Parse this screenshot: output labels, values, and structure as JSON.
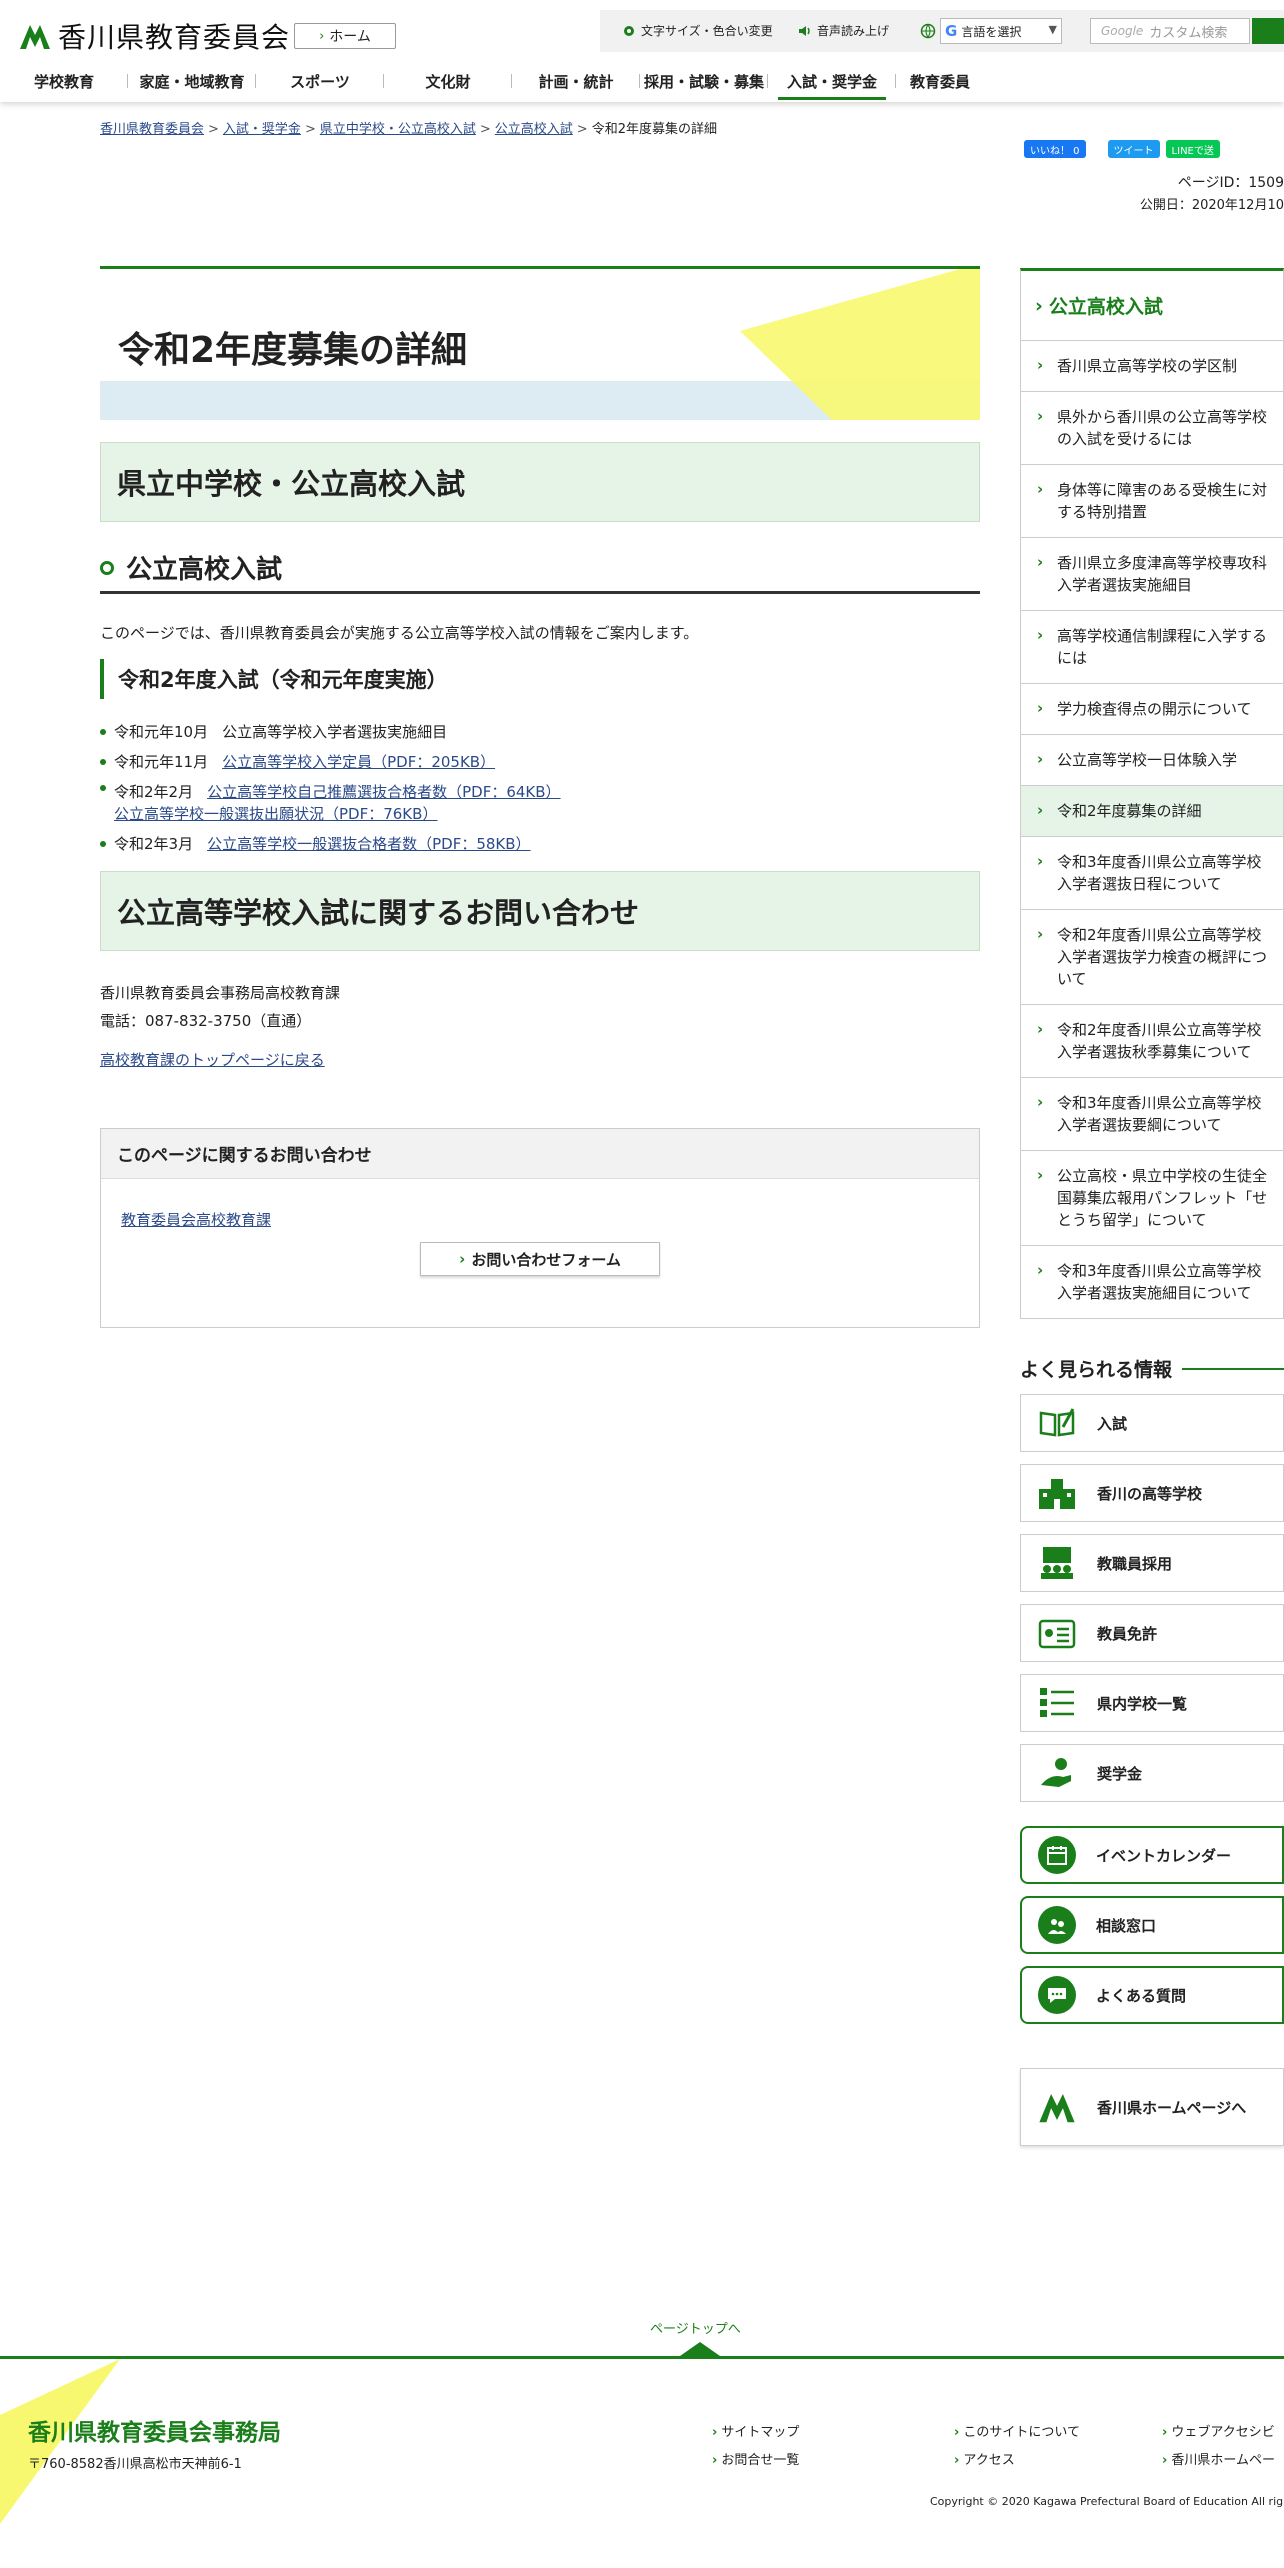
{
  "header": {
    "site_name": "香川県教育委員会",
    "home_label": "ホーム",
    "util": {
      "font_size": "文字サイズ・色合い変更",
      "voice": "音声読み上げ",
      "language": "言語を選択",
      "search_placeholder": "カスタム検索",
      "search_brand": "Google"
    },
    "nav": [
      "学校教育",
      "家庭・地域教育",
      "スポーツ",
      "文化財",
      "計画・統計",
      "採用・試験・募集",
      "入試・奨学金",
      "教育委員"
    ]
  },
  "breadcrumb": [
    "香川県教育委員会",
    "入試・奨学金",
    "県立中学校・公立高校入試",
    "公立高校入試",
    "令和2年度募集の詳細"
  ],
  "share": {
    "like": "いいね！ 0",
    "tweet": "ツイート",
    "line": "LINEで送"
  },
  "page_id": "ページID：1509",
  "published": "公開日：2020年12月10",
  "main": {
    "title": "令和2年度募集の詳細",
    "h2_1": "県立中学校・公立高校入試",
    "h3_1": "公立高校入試",
    "intro": "このページでは、香川県教育委員会が実施する公立高等学校入試の情報をご案内します。",
    "h4_1": "令和2年度入試（令和元年度実施）",
    "items": [
      {
        "date": "令和元年10月",
        "text": "公立高等学校入学者選抜実施細目"
      },
      {
        "date": "令和元年11月",
        "link": "公立高等学校入学定員（PDF：205KB）"
      },
      {
        "date": "令和2年2月",
        "link": "公立高等学校自己推薦選抜合格者数（PDF：64KB）",
        "link2": "公立高等学校一般選抜出願状況（PDF：76KB）"
      },
      {
        "date": "令和2年3月",
        "link": "公立高等学校一般選抜合格者数（PDF：58KB）"
      }
    ],
    "h2_2": "公立高等学校入試に関するお問い合わせ",
    "contact_org": "香川県教育委員会事務局高校教育課",
    "contact_tel": "電話：087-832-3750（直通）",
    "back_link": "高校教育課のトップページに戻る",
    "inquiry": {
      "heading": "このページに関するお問い合わせ",
      "dept_link": "教育委員会高校教育課",
      "form_button": "お問い合わせフォーム"
    }
  },
  "sidebar": {
    "heading": "公立高校入試",
    "items": [
      "香川県立高等学校の学区制",
      "県外から香川県の公立高等学校の入試を受けるには",
      "身体等に障害のある受検生に対する特別措置",
      "香川県立多度津高等学校専攻科入学者選抜実施細目",
      "高等学校通信制課程に入学するには",
      "学力検査得点の開示について",
      "公立高等学校一日体験入学",
      "令和2年度募集の詳細",
      "令和3年度香川県公立高等学校入学者選抜日程について",
      "令和2年度香川県公立高等学校入学者選抜学力検査の概評について",
      "令和2年度香川県公立高等学校入学者選抜秋季募集について",
      "令和3年度香川県公立高等学校入学者選抜要綱について",
      "公立高校・県立中学校の生徒全国募集広報用パンフレット「せとうち留学」について",
      "令和3年度香川県公立高等学校入学者選抜実施細目について"
    ],
    "current_index": 7,
    "popular_title": "よく見られる情報",
    "popular": [
      {
        "label": "入試",
        "icon": "open-book-icon"
      },
      {
        "label": "香川の高等学校",
        "icon": "school-building-icon"
      },
      {
        "label": "教職員採用",
        "icon": "classroom-icon"
      },
      {
        "label": "教員免許",
        "icon": "license-card-icon"
      },
      {
        "label": "県内学校一覧",
        "icon": "school-list-icon"
      },
      {
        "label": "奨学金",
        "icon": "scholarship-hand-icon"
      }
    ],
    "round_links": [
      {
        "label": "イベントカレンダー",
        "icon": "calendar-icon"
      },
      {
        "label": "相談窓口",
        "icon": "consultation-icon"
      },
      {
        "label": "よくある質問",
        "icon": "speech-bubble-icon"
      }
    ],
    "pref_link": "香川県ホームページへ"
  },
  "footer": {
    "pagetop": "ページトップへ",
    "org_name": "香川県教育委員会事務局",
    "address": "〒760-8582香川県高松市天神前6-1",
    "links": [
      "サイトマップ",
      "お問合せ一覧",
      "このサイトについて",
      "アクセス",
      "ウェブアクセシビ",
      "香川県ホームペー"
    ],
    "copyright": "Copyright © 2020 Kagawa Prefectural Board of Education All righ"
  },
  "colors": {
    "accent": "#1a7f1a",
    "h2_bg": "#e6f4e7",
    "title_band": "#ddebf3",
    "yellow": "#f8f870"
  }
}
